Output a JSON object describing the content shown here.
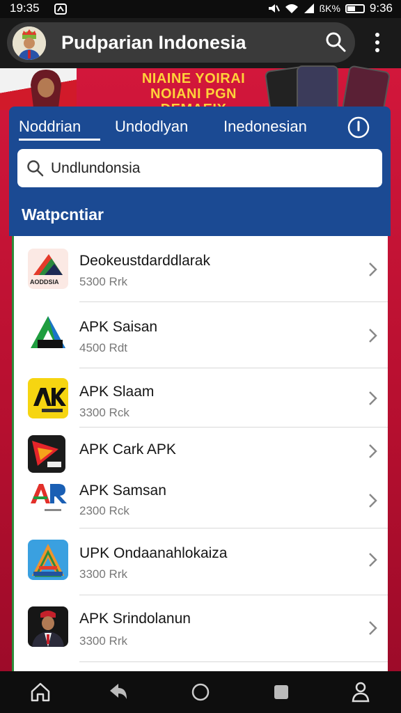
{
  "status_bar": {
    "time": "19:35",
    "indicator": "ßK%",
    "clock_right": "9:36"
  },
  "app_bar": {
    "title": "Pudparian Indonesia",
    "avatar_icon": "profile-avatar",
    "search_icon": "search-icon",
    "menu_icon": "more-vert-icon"
  },
  "banner": {
    "headline_line1": "NIAINE YOIRAI",
    "headline_line2": "NOIANI PGN DEMAEIX"
  },
  "tabs": [
    {
      "label": "Noddrian",
      "active": true
    },
    {
      "label": "Undodlyan",
      "active": false
    },
    {
      "label": "Inedonesian",
      "active": false
    }
  ],
  "search": {
    "value": "Undlundonsia",
    "placeholder": ""
  },
  "section_title": "Watpcntiar",
  "apps": [
    {
      "name": "Deokeustdarddlarak",
      "price": "5300 Rrk",
      "icon": "multicolor-triangle-icon",
      "icon_caption": "AODDSIA"
    },
    {
      "name": "APK Saisan",
      "price": "4500 Rdt",
      "icon": "green-a-logo-icon",
      "icon_caption": ""
    },
    {
      "name": "APK Slaam",
      "price": "3300 Rck",
      "icon": "yellow-ak-logo-icon",
      "icon_caption": ""
    },
    {
      "name": "APK Cark APK",
      "price": "",
      "icon": "red-play-logo-icon",
      "icon_caption": ""
    },
    {
      "name": "APK Samsan",
      "price": "2300 Rck",
      "icon": "ar-logo-icon",
      "icon_caption": ""
    },
    {
      "name": "UPK Ondaanahlokaiza",
      "price": "3300 Rrk",
      "icon": "blue-a-logo-icon",
      "icon_caption": ""
    },
    {
      "name": "APK Srindolanun",
      "price": "3300 Rrk",
      "icon": "person-photo-icon",
      "icon_caption": ""
    }
  ],
  "nav": [
    "home-icon",
    "back-icon",
    "circle-home-icon",
    "square-recents-icon",
    "accessibility-icon"
  ],
  "colors": {
    "accent_blue": "#1b4a93",
    "banner_red": "#d2173b",
    "headline_yellow": "#ffd23a"
  }
}
